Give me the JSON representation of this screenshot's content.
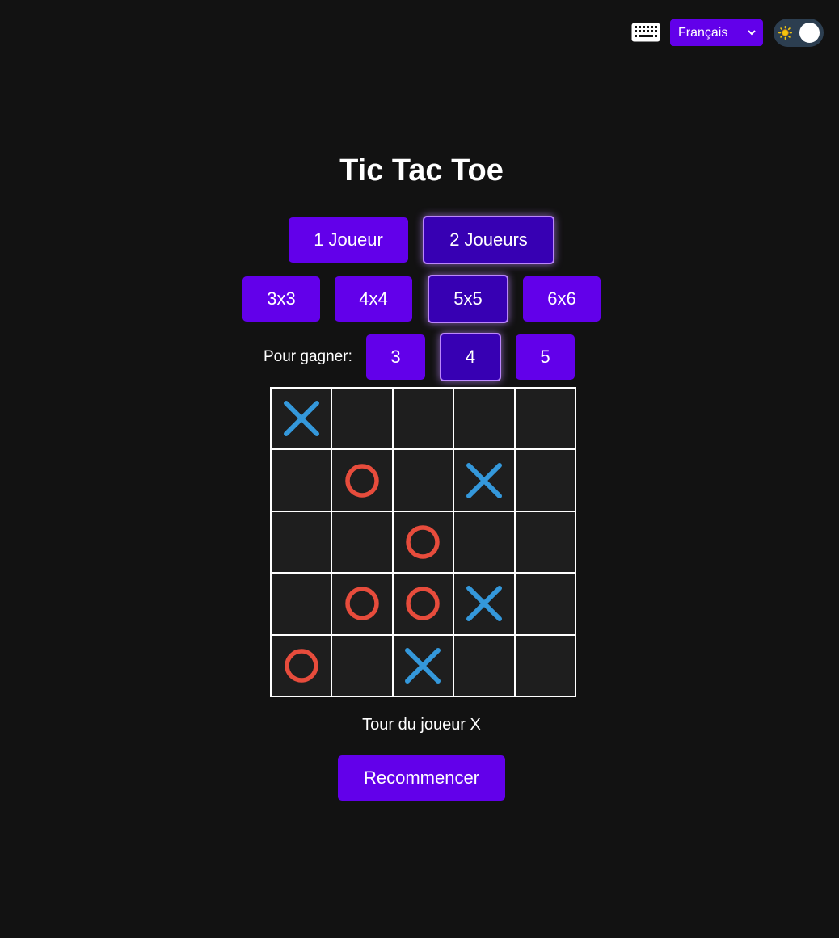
{
  "toolbar": {
    "keyboard_icon": "keyboard-icon",
    "language": "Français",
    "theme_icon": "sun-icon"
  },
  "title": "Tic Tac Toe",
  "modes": [
    "1 Joueur",
    "2 Joueurs"
  ],
  "active_mode": 1,
  "sizes": [
    "3x3",
    "4x4",
    "5x5",
    "6x6"
  ],
  "active_size": 2,
  "win_label": "Pour gagner:",
  "win_options": [
    "3",
    "4",
    "5"
  ],
  "active_win": 1,
  "board": [
    [
      "X",
      "",
      "",
      "",
      ""
    ],
    [
      "",
      "O",
      "",
      "X",
      ""
    ],
    [
      "",
      "",
      "O",
      "",
      ""
    ],
    [
      "",
      "O",
      "O",
      "X",
      ""
    ],
    [
      "O",
      "",
      "X",
      "",
      ""
    ]
  ],
  "status": "Tour du joueur X",
  "restart_label": "Recommencer",
  "colors": {
    "accent": "#6200ea",
    "active": "#3700b3",
    "active_border": "#bb86fc",
    "x_mark": "#3498db",
    "o_mark": "#e74c3c",
    "background": "#121212",
    "cell": "#1e1e1e"
  }
}
